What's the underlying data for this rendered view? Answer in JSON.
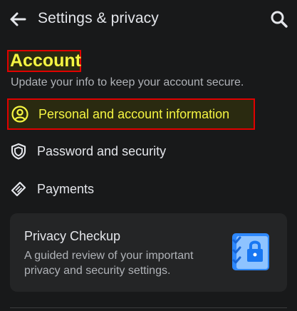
{
  "header": {
    "title": "Settings & privacy",
    "back_icon": "arrow-left-icon",
    "search_icon": "search-icon"
  },
  "account_section": {
    "title": "Account",
    "description": "Update your info to keep your account secure.",
    "items": [
      {
        "label": "Personal and account information",
        "icon": "person-circle-icon",
        "highlighted": true
      },
      {
        "label": "Password and security",
        "icon": "shield-icon",
        "highlighted": false
      },
      {
        "label": "Payments",
        "icon": "tag-icon",
        "highlighted": false
      }
    ]
  },
  "privacy_checkup_card": {
    "title": "Privacy Checkup",
    "description": "A guided review of your important privacy and security settings.",
    "icon": "clipboard-lock-icon"
  },
  "colors": {
    "background": "#18191a",
    "card": "#242526",
    "highlight_text": "#f5f542",
    "highlight_border": "#e00000",
    "primary_text": "#e4e6eb",
    "secondary_text": "#b0b3b8",
    "accent_blue": "#2d88ff"
  }
}
